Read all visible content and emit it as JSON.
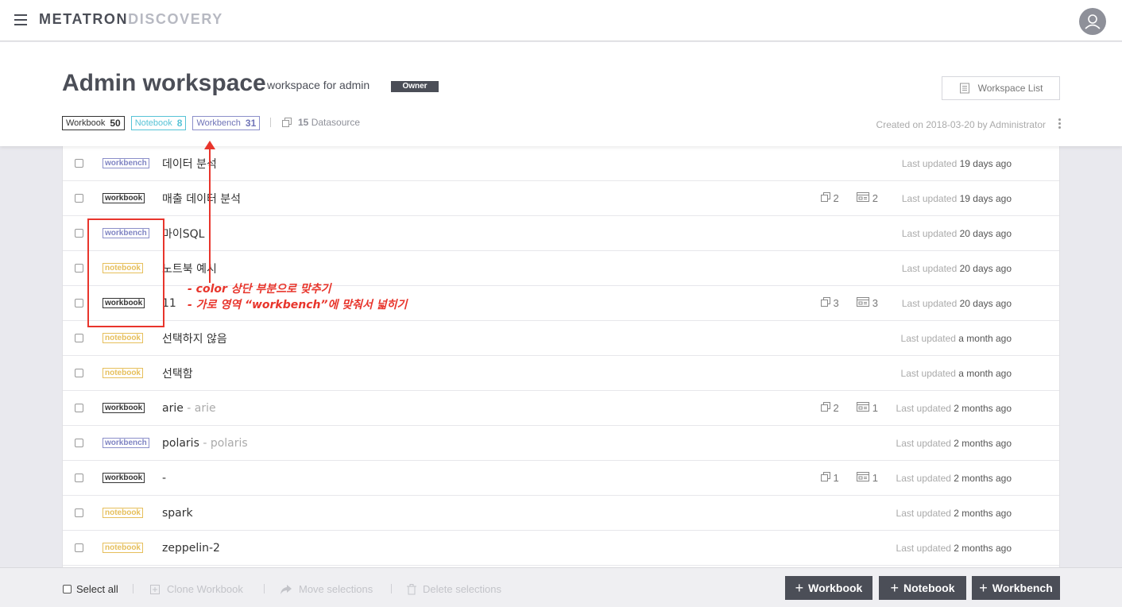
{
  "app": {
    "logo_part1": "METATRON",
    "logo_part2": "DISCOVERY"
  },
  "workspace": {
    "title": "Admin workspace",
    "description": "workspace for admin",
    "role_badge": "Owner",
    "list_button": "Workspace List",
    "created": "Created on 2018-03-20 by Administrator",
    "counts": {
      "workbook_label": "Workbook",
      "workbook_count": "50",
      "notebook_label": "Notebook",
      "notebook_count": "8",
      "workbench_label": "Workbench",
      "workbench_count": "31"
    },
    "datasource_count": "15",
    "datasource_label": "Datasource"
  },
  "items": [
    {
      "type": "workbench",
      "name": "데이터 분석",
      "sub": "",
      "ds": "",
      "dash": "",
      "updated_prefix": "Last updated",
      "updated": "19 days ago"
    },
    {
      "type": "workbook",
      "name": "매출 데이터 분석",
      "sub": "",
      "ds": "2",
      "dash": "2",
      "updated_prefix": "Last updated",
      "updated": "19 days ago"
    },
    {
      "type": "workbench",
      "name": "마이SQL",
      "sub": "",
      "ds": "",
      "dash": "",
      "updated_prefix": "Last updated",
      "updated": "20 days ago"
    },
    {
      "type": "notebook",
      "name": "노트북 예시",
      "sub": "",
      "ds": "",
      "dash": "",
      "updated_prefix": "Last updated",
      "updated": "20 days ago"
    },
    {
      "type": "workbook",
      "name": "11",
      "sub": "",
      "ds": "3",
      "dash": "3",
      "updated_prefix": "Last updated",
      "updated": "20 days ago"
    },
    {
      "type": "notebook",
      "name": "선택하지 않음",
      "sub": "",
      "ds": "",
      "dash": "",
      "updated_prefix": "Last updated",
      "updated": "a month ago"
    },
    {
      "type": "notebook",
      "name": "선택함",
      "sub": "",
      "ds": "",
      "dash": "",
      "updated_prefix": "Last updated",
      "updated": "a month ago"
    },
    {
      "type": "workbook",
      "name": "arie",
      "sub": " - arie",
      "ds": "2",
      "dash": "1",
      "updated_prefix": "Last updated",
      "updated": "2 months ago"
    },
    {
      "type": "workbench",
      "name": "polaris",
      "sub": " - polaris",
      "ds": "",
      "dash": "",
      "updated_prefix": "Last updated",
      "updated": "2 months ago"
    },
    {
      "type": "workbook",
      "name": "-",
      "sub": "",
      "ds": "1",
      "dash": "1",
      "updated_prefix": "Last updated",
      "updated": "2 months ago"
    },
    {
      "type": "notebook",
      "name": "spark",
      "sub": "",
      "ds": "",
      "dash": "",
      "updated_prefix": "Last updated",
      "updated": "2 months ago"
    },
    {
      "type": "notebook",
      "name": "zeppelin-2",
      "sub": "",
      "ds": "",
      "dash": "",
      "updated_prefix": "Last updated",
      "updated": "2 months ago"
    }
  ],
  "annotation": {
    "line1": "- color 상단 부분으로 맞추기",
    "line2": "- 가로 영역 “workbench”에 맞춰서 넓히기"
  },
  "bottom": {
    "select_all": "Select all",
    "clone": "Clone Workbook",
    "move": "Move selections",
    "delete": "Delete selections",
    "add_workbook": "Workbook",
    "add_notebook": "Notebook",
    "add_workbench": "Workbench"
  },
  "colors": {
    "dark": "#4b4e57",
    "workbook": "#333333",
    "notebook": "#e6bf5b",
    "workbench": "#8b8fc9",
    "annotation": "#e8352c"
  }
}
